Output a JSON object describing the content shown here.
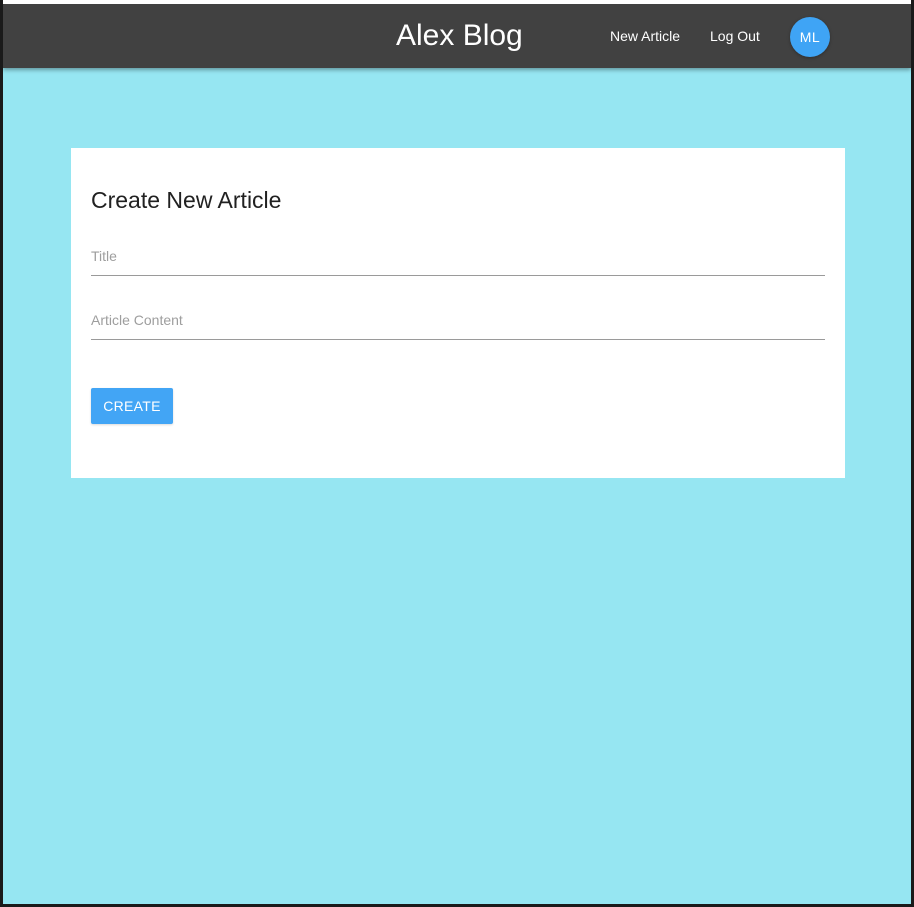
{
  "header": {
    "brand": "Alex Blog",
    "nav": {
      "new_article": "New Article",
      "log_out": "Log Out"
    },
    "avatar_initials": "ML"
  },
  "form": {
    "title": "Create New Article",
    "fields": {
      "title": {
        "placeholder": "Title",
        "value": ""
      },
      "content": {
        "placeholder": "Article Content",
        "value": ""
      }
    },
    "submit_label": "CREATE"
  },
  "colors": {
    "appbar": "#414141",
    "background": "#96e6f2",
    "accent": "#42a5f5"
  }
}
